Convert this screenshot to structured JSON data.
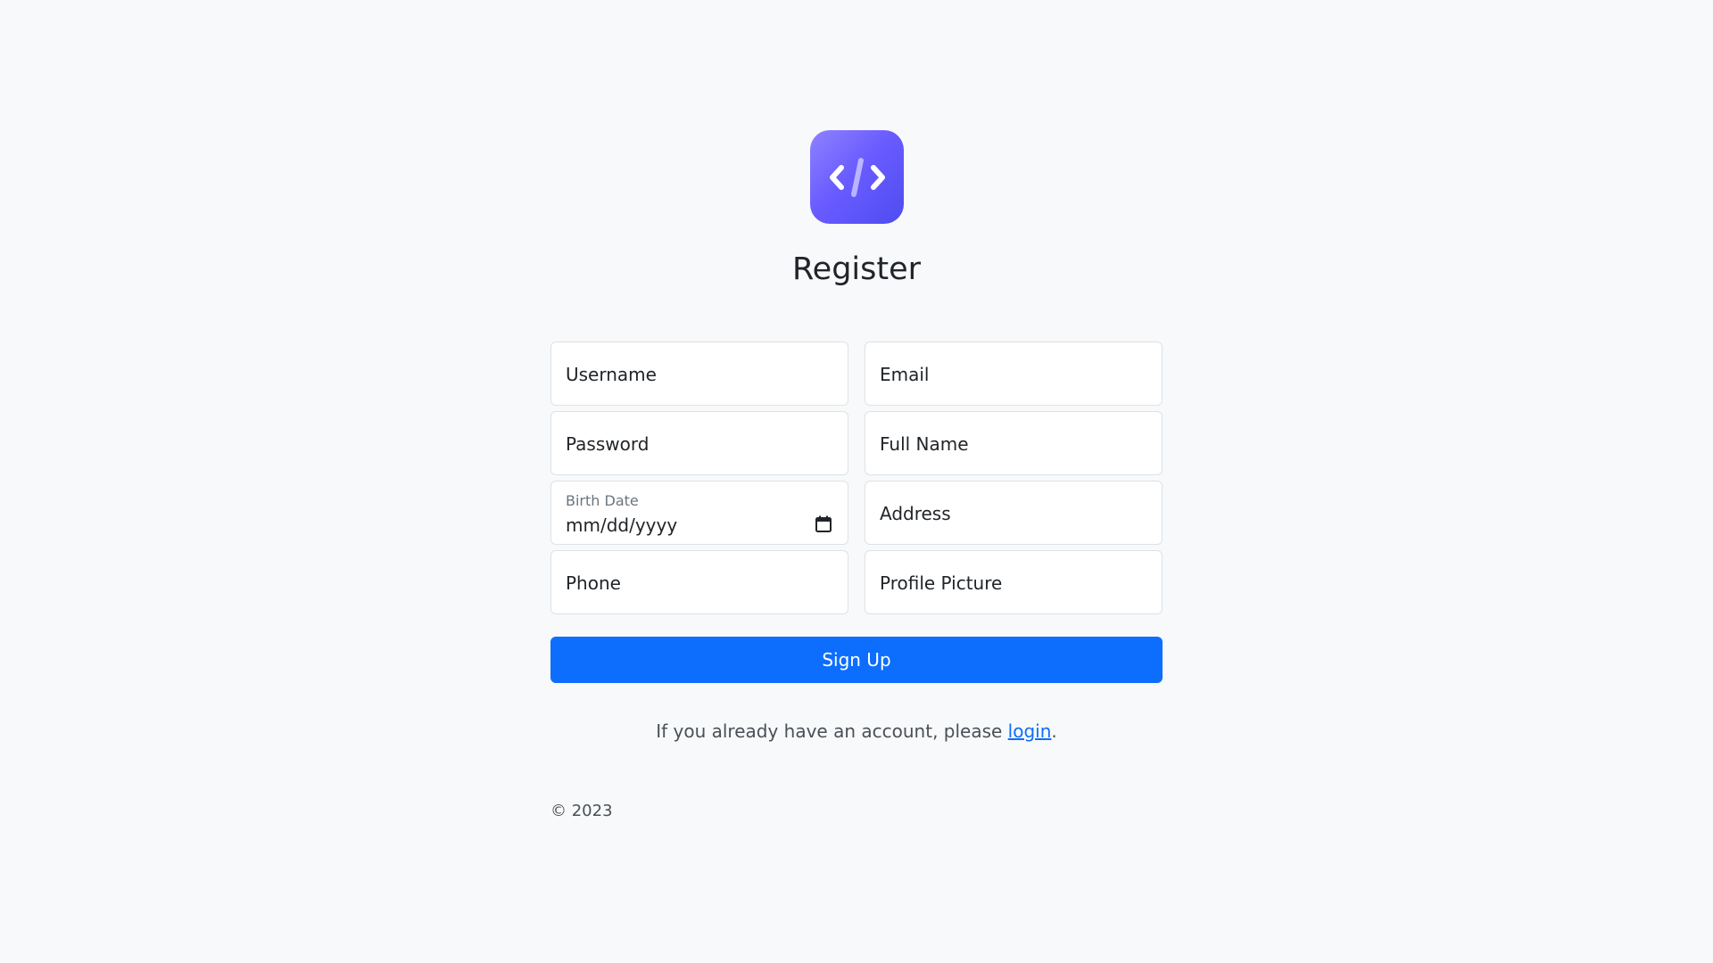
{
  "logo": {
    "icon": "code-brackets-icon",
    "colors": [
      "#8e82ff",
      "#4f4cf0"
    ]
  },
  "title": "Register",
  "form": {
    "username_placeholder": "Username",
    "email_placeholder": "Email",
    "password_placeholder": "Password",
    "fullname_placeholder": "Full Name",
    "birthdate_label": "Birth Date",
    "birthdate_value": "mm/dd/yyyy",
    "address_placeholder": "Address",
    "phone_placeholder": "Phone",
    "profile_picture_placeholder": "Profile Picture",
    "submit_label": "Sign Up"
  },
  "login_prompt": {
    "before": "If you already have an account, please ",
    "link": "login",
    "after": "."
  },
  "footer": {
    "copyright": "© 2023"
  },
  "colors": {
    "primary": "#0d6efd",
    "background": "#f8f9fa"
  }
}
